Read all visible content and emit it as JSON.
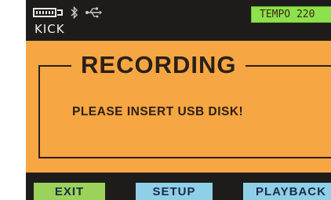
{
  "status_bar": {
    "track_label": "KICK",
    "tempo_text": "TEMPO 220",
    "tempo_color": "#8fe04d",
    "icons": [
      "battery-icon",
      "bluetooth-icon",
      "usb-icon"
    ]
  },
  "dialog": {
    "title": "RECORDING",
    "message": "PLEASE INSERT USB DISK!",
    "background_color": "#f6a642"
  },
  "softkeys": {
    "exit_label": "EXIT",
    "setup_label": "SETUP",
    "playback_label": "PLAYBACK",
    "exit_color": "#9bd35a",
    "setup_color": "#8fd0e8",
    "playback_color": "#8fd0e8"
  }
}
